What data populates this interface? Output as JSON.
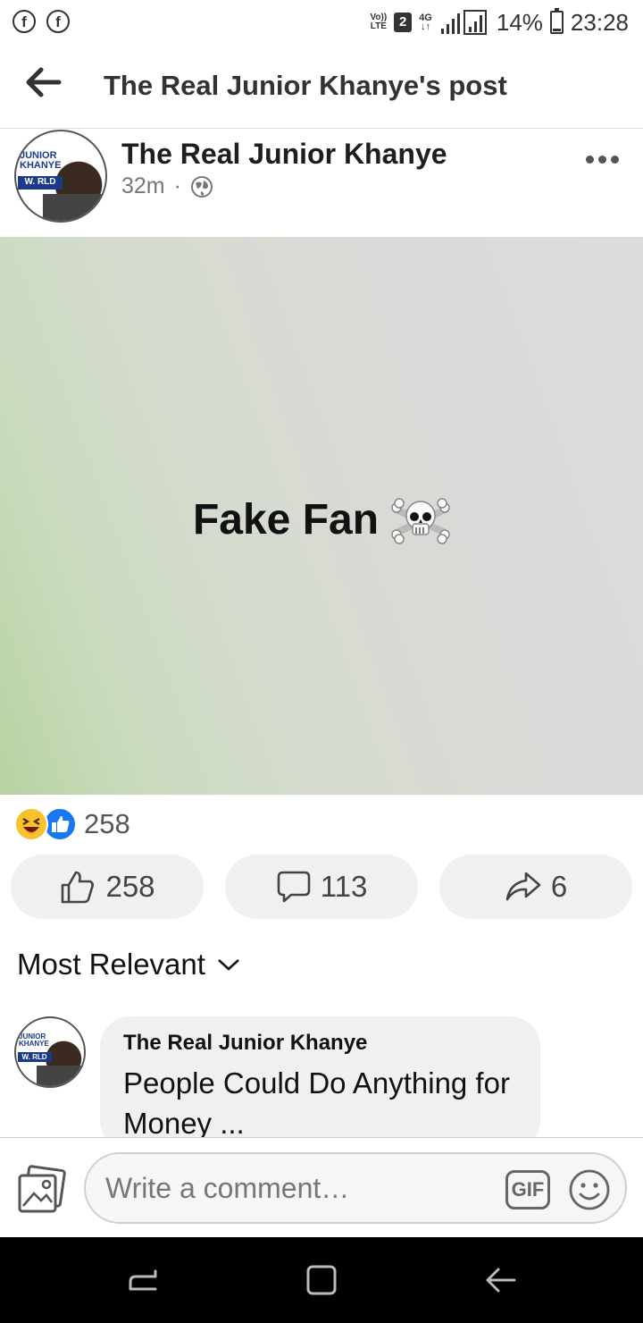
{
  "status_bar": {
    "notif_icon_1": "facebook-icon",
    "notif_icon_2": "facebook-icon",
    "volte_line1": "Vo))",
    "volte_line2": "LTE",
    "sim": "2",
    "network_top": "4G",
    "network_bottom": "↓↑",
    "battery_pct": "14%",
    "time": "23:28"
  },
  "header": {
    "title": "The Real Junior Khanye's post"
  },
  "post": {
    "author": "The Real Junior Khanye",
    "time": "32m",
    "privacy_icon": "globe-icon",
    "avatar_logo_top": "JUNIOR\nKHANYE",
    "avatar_logo_box": "W.  RLD",
    "text": "Fake Fan",
    "emoji": "☠️"
  },
  "reactions": {
    "types": [
      "haha",
      "like"
    ],
    "total": "258"
  },
  "actions": {
    "like_count": "258",
    "comment_count": "113",
    "share_count": "6"
  },
  "comments": {
    "sort_label": "Most Relevant",
    "items": [
      {
        "author": "The Real Junior Khanye",
        "text": "People Could Do Anything for Money ..."
      }
    ]
  },
  "composer": {
    "placeholder": "Write a comment…",
    "gif_label": "GIF"
  },
  "colors": {
    "like_blue": "#1877f2",
    "haha_yellow": "#f7c22b",
    "button_bg": "#eff0f2"
  }
}
